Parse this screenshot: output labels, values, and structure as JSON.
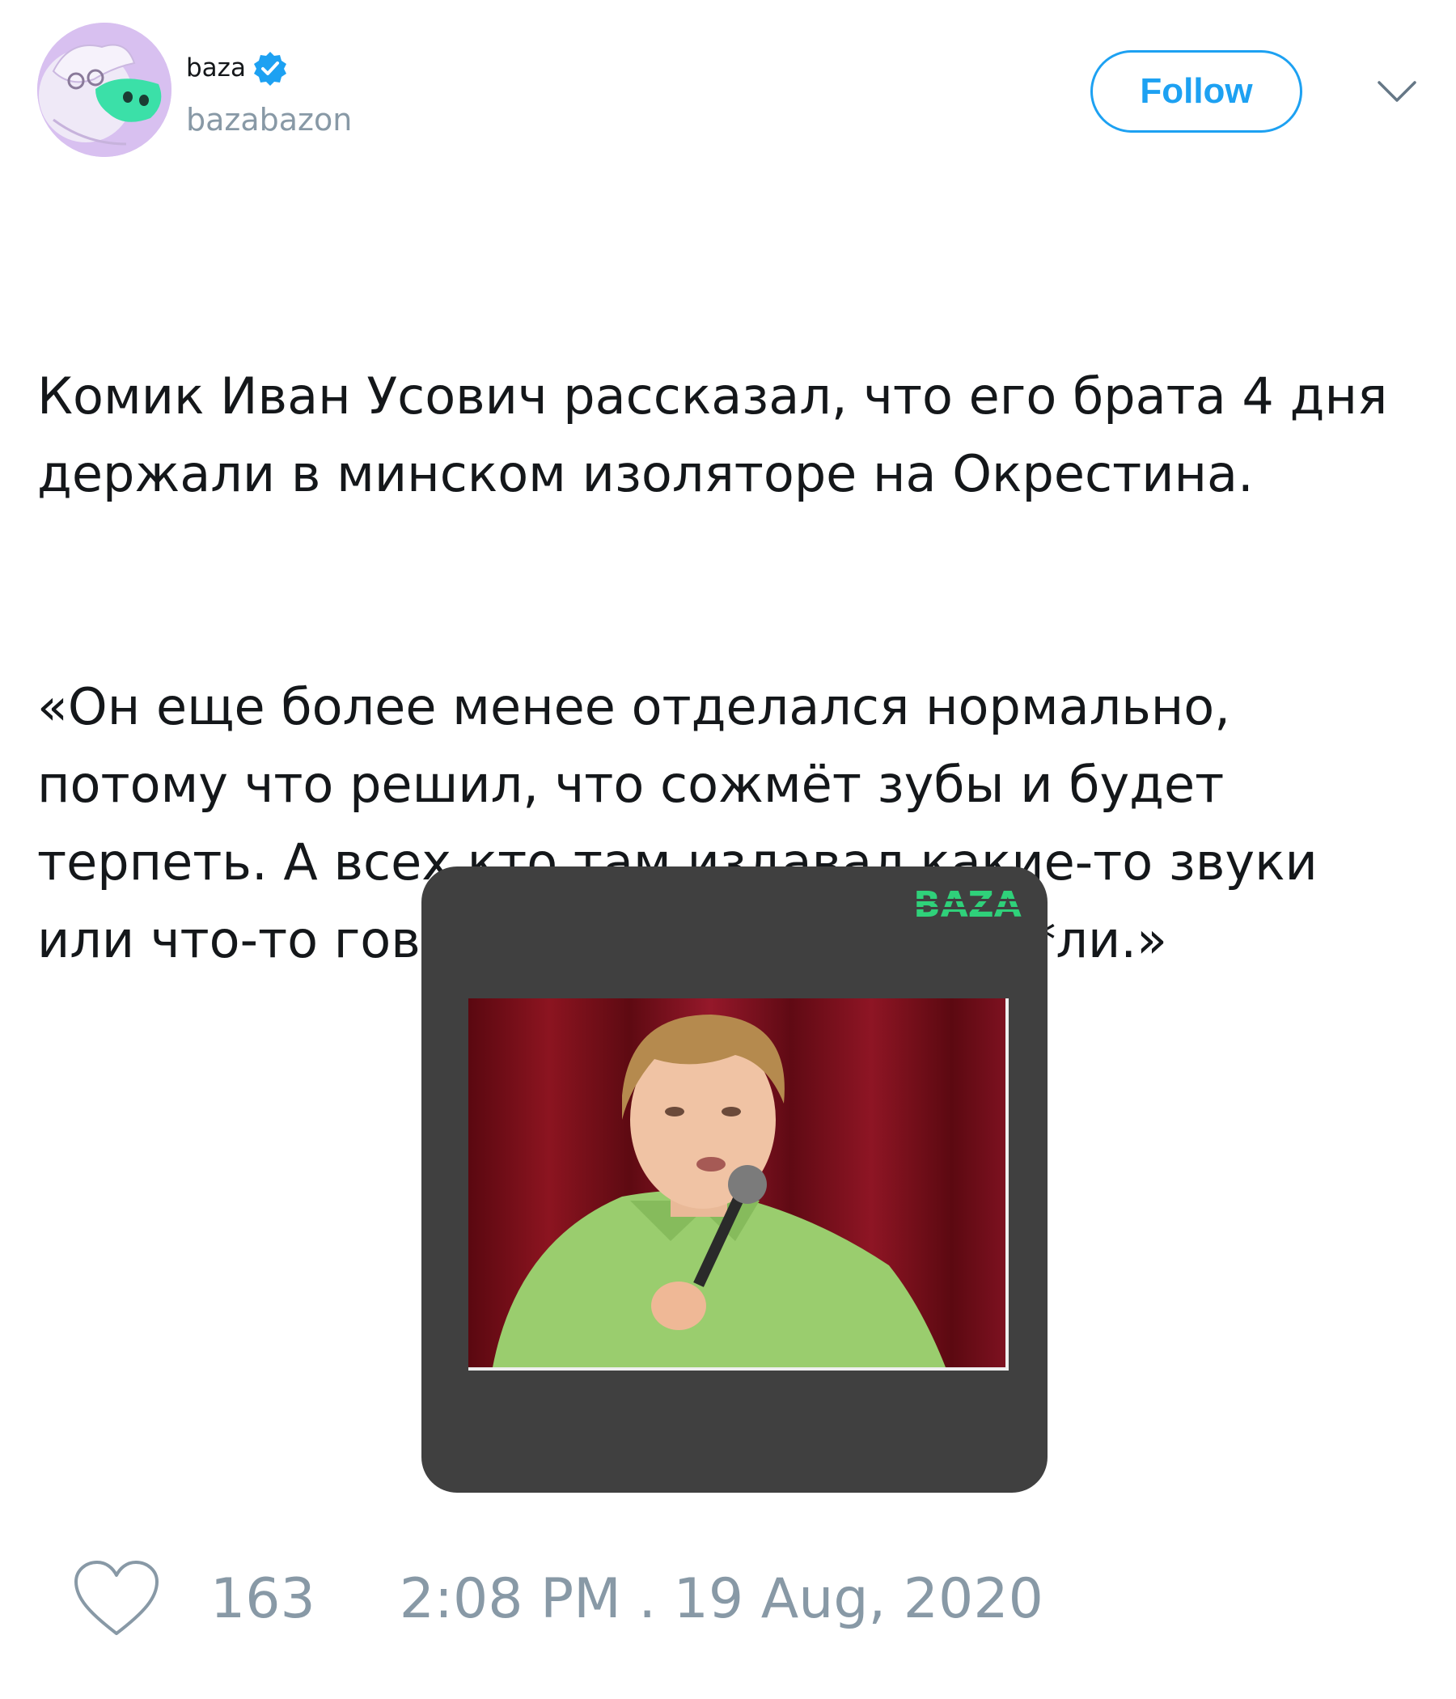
{
  "user": {
    "display_name": "baza",
    "handle": "bazabazon",
    "verified": true,
    "avatar_icon": "cartoon-character-avatar"
  },
  "follow_button": {
    "label": "Follow"
  },
  "menu_icon": "chevron-down-icon",
  "tweet": {
    "paragraph1": "Комик Иван Усович рассказал, что его брата 4 дня держали в минском изоляторе на Окрестина.",
    "paragraph2": "«Он еще более менее отделался нормально, потому что решил, что сожмёт зубы и будет терпеть. А всех кто там издавал какие-то звуки или что-то говорил, всех жестко п****ли.»"
  },
  "media": {
    "logo_text": "BAZA",
    "photo": "comedian-with-microphone-photo",
    "colors": {
      "card_bg": "#404040",
      "logo_green": "#2fd17a",
      "curtain": "#7a0f1a"
    }
  },
  "footer": {
    "likes": "163",
    "timestamp": "2:08 PM . 19 Aug, 2020"
  },
  "colors": {
    "accent": "#1da1f2",
    "muted": "#8899a6",
    "text": "#14171a"
  }
}
